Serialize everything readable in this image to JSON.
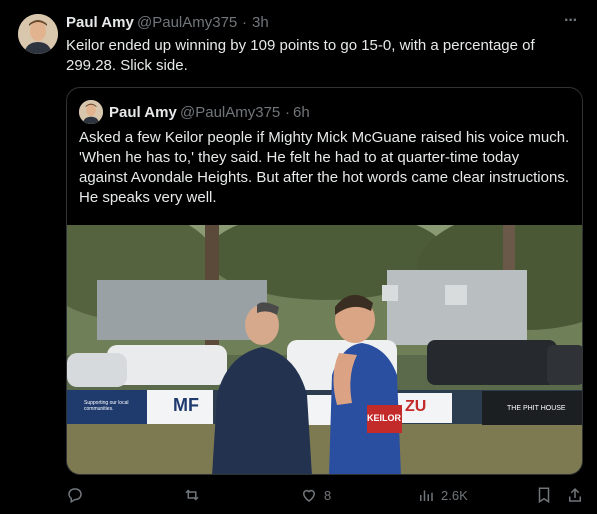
{
  "tweet": {
    "author_name": "Paul Amy",
    "handle": "@PaulAmy375",
    "separator": "·",
    "time": "3h",
    "more": "···",
    "text": "Keilor ended up winning by 109 points to go 15-0, with a percentage of 299.28.  Slick side."
  },
  "quote": {
    "author_name": "Paul Amy",
    "handle": "@PaulAmy375",
    "separator": "·",
    "time": "6h",
    "text": "Asked a few Keilor people if Mighty Mick McGuane raised his voice much. 'When he has to,' they said. He felt he had to at quarter-time today against Avondale Heights. But after the hot words came clear instructions. He speaks very well.",
    "photo_signs": [
      "Supporting our local communities.",
      "MF",
      "ZU",
      "THE PHIT HOUSE",
      "KEILOR"
    ]
  },
  "actions": {
    "reply_count": "",
    "retweet_count": "",
    "like_count": "8",
    "views_count": "2.6K"
  },
  "icons": [
    "reply-icon",
    "retweet-icon",
    "like-icon",
    "views-icon",
    "bookmark-icon",
    "share-icon"
  ],
  "colors": {
    "background": "#000000",
    "text": "#e7e9ea",
    "muted": "#71767b",
    "border": "#2f3336"
  }
}
